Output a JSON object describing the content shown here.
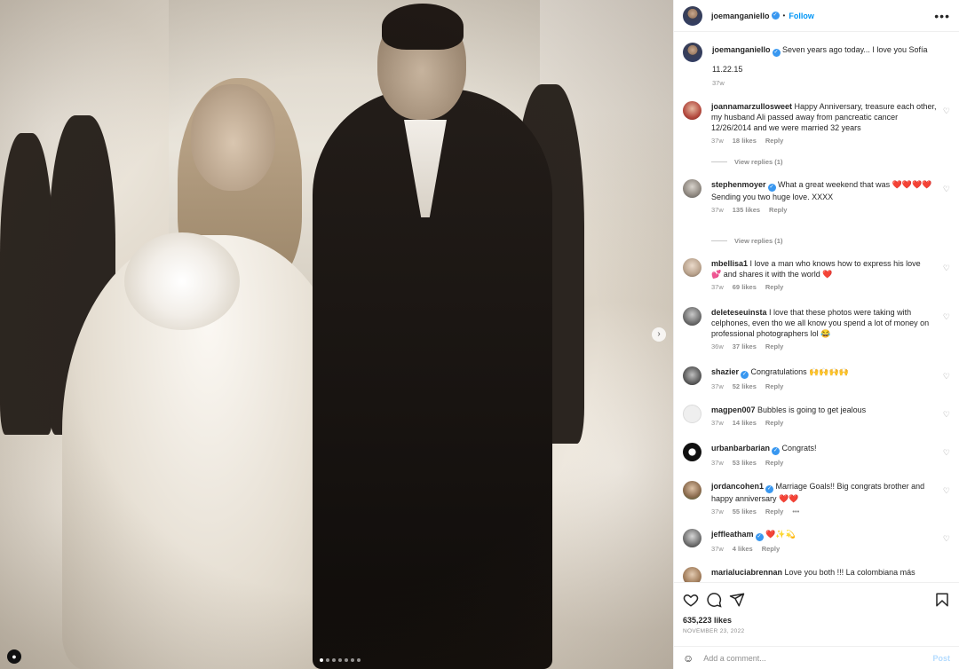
{
  "post": {
    "author": "joemanganiello",
    "follow_label": "Follow",
    "separator": "•",
    "more": "•••",
    "caption": "Seven years ago today... I love you Sofía",
    "caption_date": "11.22.15",
    "caption_age": "37w",
    "likes": "635,223 likes",
    "date": "NOVEMBER 23, 2022",
    "add_comment_placeholder": "Add a comment...",
    "post_label": "Post"
  },
  "comments": [
    {
      "user": "joannamarzullosweet",
      "text": "Happy Anniversary, treasure each other, my husband Ali passed away from pancreatic cancer 12/26/2014 and we were married 32 years",
      "age": "37w",
      "likes": "18 likes",
      "reply": "Reply",
      "view_replies": "View replies (1)"
    },
    {
      "user": "stephenmoyer",
      "text": "What a great weekend that was",
      "hearts": "❤️❤️❤️❤️",
      "line2": "Sending you two huge love. XXXX",
      "age": "37w",
      "likes": "135 likes",
      "reply": "Reply",
      "view_replies": "View replies (1)"
    },
    {
      "user": "mbellisa1",
      "text": "I love a man who knows how to express his love",
      "line2": "💕 and shares it with the world ❤️",
      "age": "37w",
      "likes": "69 likes",
      "reply": "Reply"
    },
    {
      "user": "deleteseuinsta",
      "text": "I love that these photos were taking with celphones, even tho we all know you spend a lot of money on professional photographers lol 😂",
      "age": "36w",
      "likes": "37 likes",
      "reply": "Reply"
    },
    {
      "user": "shazier",
      "text": "Congratulations 🙌🙌🙌🙌",
      "age": "37w",
      "likes": "52 likes",
      "reply": "Reply"
    },
    {
      "user": "magpen007",
      "text": "Bubbles is going to get jealous",
      "age": "37w",
      "likes": "14 likes",
      "reply": "Reply"
    },
    {
      "user": "urbanbarbarian",
      "text": "Congrats!",
      "age": "37w",
      "likes": "53 likes",
      "reply": "Reply"
    },
    {
      "user": "jordancohen1",
      "text": "Marriage Goals!! Big congrats brother and happy anniversary ❤️❤️",
      "age": "37w",
      "likes": "55 likes",
      "reply": "Reply",
      "more": "•••"
    },
    {
      "user": "jeffleatham",
      "text": "❤️✨💫",
      "age": "37w",
      "likes": "4 likes",
      "reply": "Reply"
    },
    {
      "user": "marialuciabrennan",
      "text": "Love you both !!! La colombiana más"
    }
  ],
  "icons": {
    "more_options": "more-options-icon",
    "like": "heart-icon",
    "comment": "comment-icon",
    "share": "send-icon",
    "save": "bookmark-icon",
    "emoji": "emoji-icon",
    "next": "chevron-right-icon",
    "tag": "user-tag-icon",
    "comment_like": "small-heart-icon",
    "verified": "verified-badge-icon"
  },
  "colors": {
    "link_blue": "#0095f6",
    "verified_blue": "#3897f0",
    "muted_text": "#8e8e8e",
    "post_button_disabled": "#b3dbff"
  },
  "carousel": {
    "slides": 7,
    "active_index": 0
  }
}
